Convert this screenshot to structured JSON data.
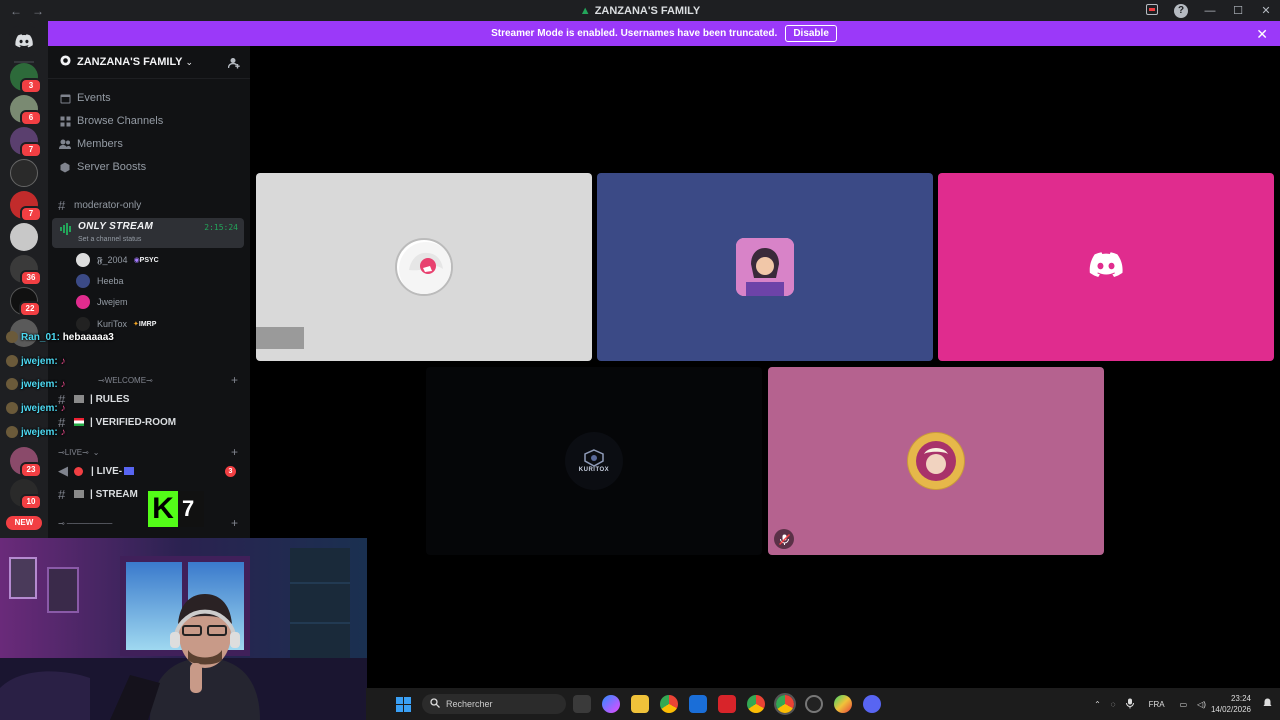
{
  "window": {
    "title": "ZANZANA'S FAMILY",
    "nav_back": "←",
    "nav_forward": "→",
    "help": "?",
    "minimize": "—",
    "maximize": "☐",
    "close": "✕"
  },
  "banner": {
    "message": "Streamer Mode is enabled. Usernames have been truncated.",
    "button": "Disable",
    "close": "✕"
  },
  "rail": {
    "badges": [
      "3",
      "6",
      "7",
      "7",
      "36",
      "22",
      "23",
      "10"
    ],
    "new_label": "NEW"
  },
  "server": {
    "name": "ZANZANA'S FAMILY",
    "menu": [
      {
        "label": "Events"
      },
      {
        "label": "Browse Channels"
      },
      {
        "label": "Members"
      },
      {
        "label": "Server Boosts"
      }
    ],
    "channels": {
      "moderator": "moderator-only",
      "voice_channel": {
        "name": "ONLY STREAM",
        "timer": "2:15:24",
        "status": "Set a channel status",
        "users": [
          {
            "name": "𝕱_2004",
            "tag": "PSYC"
          },
          {
            "name": "Heeba",
            "tag": ""
          },
          {
            "name": "Jwejem",
            "tag": ""
          },
          {
            "name": "KuriTox",
            "tag": "IMRP"
          }
        ]
      },
      "welcome_category": "WELCOME",
      "rules": "| RULES",
      "verified": "| VERIFIED-ROOM",
      "live_category": "LIVE",
      "live_channel": "| LIVE-",
      "live_badge": "3",
      "stream_channel": "| STREAM"
    }
  },
  "chat_overlay": [
    {
      "user": "Ran_01:",
      "text": "hebaaaaa3"
    },
    {
      "user": "jwejem:",
      "text": ""
    },
    {
      "user": "jwejem:",
      "text": ""
    },
    {
      "user": "jwejem:",
      "text": ""
    },
    {
      "user": "jwejem:",
      "text": ""
    }
  ],
  "tiles": [
    {
      "id": "user-1",
      "bg": "#d9d9d9"
    },
    {
      "id": "user-2",
      "bg": "#3b4a86"
    },
    {
      "id": "user-3",
      "bg": "#e02c8e"
    },
    {
      "id": "user-4",
      "bg": "#050608"
    },
    {
      "id": "user-5",
      "bg": "#b5628f"
    }
  ],
  "kuritox_logo_text": "KURITOX",
  "k7_logo": {
    "letter": "K",
    "number": "7"
  },
  "taskbar": {
    "search_placeholder": "Rechercher",
    "lang": "FRA",
    "time": "23:24",
    "date": "14/02/2026"
  }
}
